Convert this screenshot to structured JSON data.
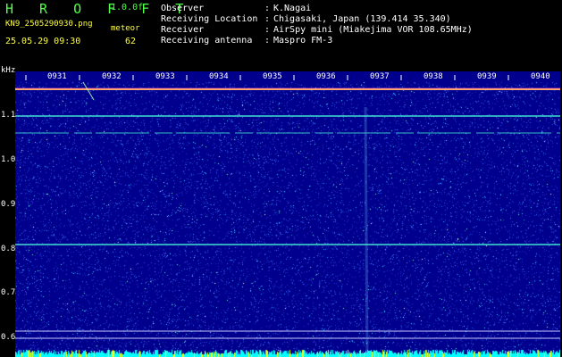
{
  "header": {
    "app_title": "H R O F F T",
    "app_version": "1.0.0f",
    "filename": "KN9_2505290930.png",
    "meteor_label": "meteor",
    "datetime": "25.05.29 09:30",
    "meteor_count": "62"
  },
  "info": [
    {
      "label": "Observer",
      "value": "K.Nagai"
    },
    {
      "label": "Receiving Location",
      "value": "Chigasaki, Japan (139.414 35.340)"
    },
    {
      "label": "Receiver",
      "value": "AirSpy mini (Miakejima VOR 108.65MHz)"
    },
    {
      "label": "Receiving antenna",
      "value": "Maspro FM-3"
    }
  ],
  "colon": ":",
  "axis": {
    "unit": "kHz",
    "x_ticks": [
      "0931",
      "0932",
      "0933",
      "0934",
      "0935",
      "0936",
      "0937",
      "0938",
      "0939",
      "0940"
    ],
    "y_ticks": [
      "1.1",
      "1.0",
      "0.9",
      "0.8",
      "0.7",
      "0.6"
    ]
  },
  "colors": {
    "background": "#000000",
    "plot_background": "#00008c",
    "title_green": "#52ff4a",
    "label_yellow": "#ffff44",
    "noise_yellow": "#ffff00",
    "noise_cyan": "#00ffff",
    "line_cyan": "#40e0d0"
  }
}
